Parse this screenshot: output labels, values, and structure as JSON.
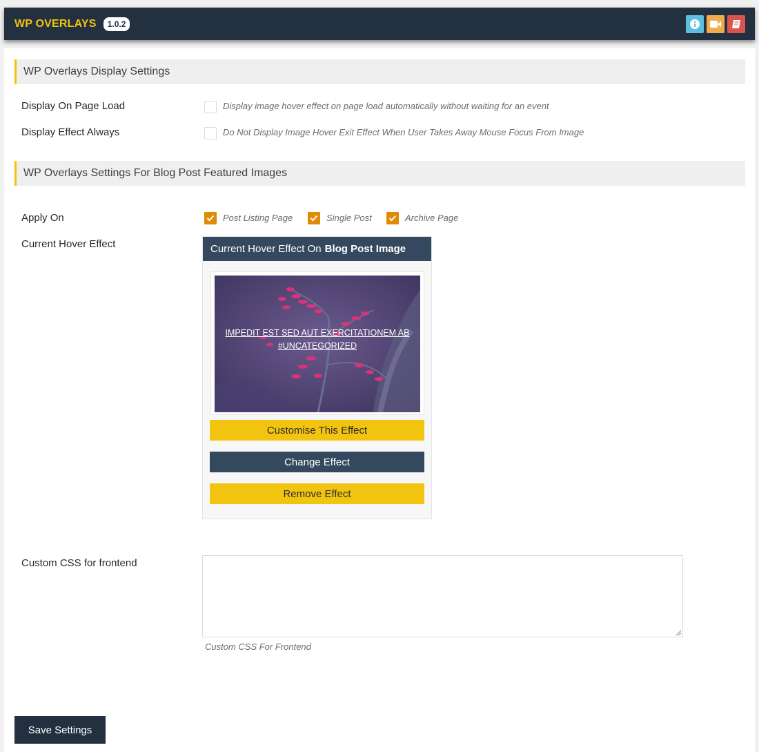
{
  "header": {
    "brand": "WP OVERLAYS",
    "version": "1.0.2",
    "icons": [
      {
        "name": "info-icon",
        "color": "#5bc0de"
      },
      {
        "name": "video-icon",
        "color": "#f0ad4e"
      },
      {
        "name": "book-icon",
        "color": "#d9534f"
      }
    ]
  },
  "display_settings": {
    "heading": "WP Overlays Display Settings",
    "page_load": {
      "label": "Display On Page Load",
      "description": "Display image hover effect on page load automatically without waiting for an event",
      "checked": false
    },
    "always": {
      "label": "Display Effect Always",
      "description": "Do Not Display Image Hover Exit Effect When User Takes Away Mouse Focus From Image",
      "checked": false
    }
  },
  "blog_settings": {
    "heading": "WP Overlays Settings For Blog Post Featured Images",
    "apply_on": {
      "label": "Apply On",
      "options": [
        {
          "label": "Post Listing Page",
          "checked": true
        },
        {
          "label": "Single Post",
          "checked": true
        },
        {
          "label": "Archive Page",
          "checked": true
        }
      ]
    },
    "current_effect": {
      "label": "Current Hover Effect",
      "box_title_prefix": "Current Hover Effect On",
      "box_title_bold": "Blog Post Image",
      "preview_line1": "IMPEDIT EST SED AUT EXERCITATIONEM AB",
      "preview_line2": "#UNCATEGORIZED",
      "buttons": {
        "customise": "Customise This Effect",
        "change": "Change Effect",
        "remove": "Remove Effect"
      }
    }
  },
  "custom_css": {
    "label": "Custom CSS for frontend",
    "value": "",
    "help": "Custom CSS For Frontend"
  },
  "save_label": "Save Settings",
  "colors": {
    "accent": "#f2c40f",
    "dark": "#23303f",
    "checkbox": "#e08a06"
  }
}
